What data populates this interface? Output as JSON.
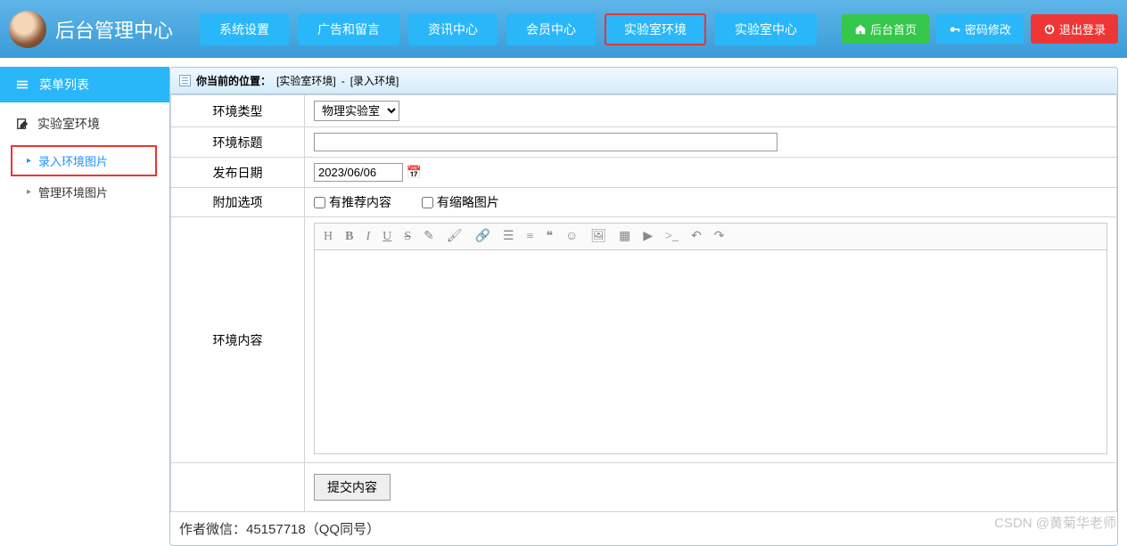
{
  "header": {
    "title": "后台管理中心",
    "nav": [
      "系统设置",
      "广告和留言",
      "资讯中心",
      "会员中心",
      "实验室环境",
      "实验室中心"
    ],
    "nav_active_index": 4,
    "home_label": "后台首页",
    "password_label": "密码修改",
    "logout_label": "退出登录"
  },
  "sidebar": {
    "menu_title": "菜单列表",
    "section_label": "实验室环境",
    "items": [
      {
        "label": "录入环境图片",
        "active": true
      },
      {
        "label": "管理环境图片",
        "active": false
      }
    ]
  },
  "breadcrumb": {
    "prefix": "你当前的位置：",
    "part1": "[实验室环境]",
    "sep": "-",
    "part2": "[录入环境]"
  },
  "form": {
    "type_label": "环境类型",
    "type_value": "物理实验室",
    "title_label": "环境标题",
    "title_value": "",
    "date_label": "发布日期",
    "date_value": "2023/06/06",
    "options_label": "附加选项",
    "opt_recommend": "有推荐内容",
    "opt_thumb": "有缩略图片",
    "content_label": "环境内容",
    "submit_label": "提交内容"
  },
  "editor_icons": [
    "heading-icon",
    "bold-icon",
    "italic-icon",
    "underline-icon",
    "strike-icon",
    "eraser-icon",
    "brush-icon",
    "link-icon",
    "list-icon",
    "ordered-list-icon",
    "quote-icon",
    "emoji-icon",
    "image-icon",
    "table-icon",
    "video-icon",
    "code-icon",
    "undo-icon",
    "redo-icon"
  ],
  "footer": {
    "text": "作者微信：45157718（QQ同号）"
  },
  "watermark": "CSDN @黄菊华老师"
}
